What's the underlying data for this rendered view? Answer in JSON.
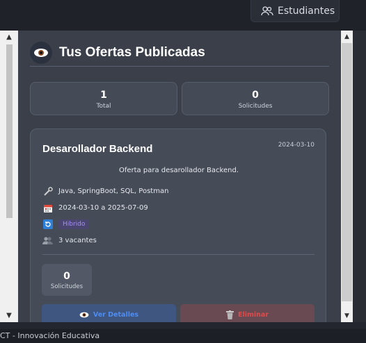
{
  "topbar": {
    "students_label": "Estudiantes"
  },
  "modal": {
    "title": "Tus Ofertas Publicadas",
    "stats": [
      {
        "value": "1",
        "label": "Total"
      },
      {
        "value": "0",
        "label": "Solicitudes"
      }
    ]
  },
  "offer": {
    "title": "Desarollador Backend",
    "date": "2024-03-10",
    "description": "Oferta para desarollador Backend.",
    "skills": "Java, SpringBoot, SQL, Postman",
    "period": "2024-03-10 a 2025-07-09",
    "modality": "Hibrido",
    "vacancies": "3 vacantes",
    "requests_value": "0",
    "requests_label": "Solicitudes",
    "view_label": "Ver Detalles",
    "delete_label": "Eliminar"
  },
  "footer": {
    "text": "CT - Innovación Educativa"
  },
  "colors": {
    "panel": "#3a3f4a",
    "accent": "#2fbf9a",
    "view": "#4f8cf0",
    "delete": "#e04a4a",
    "badge": "#a48ff5"
  },
  "icons": [
    "users-icon",
    "eye-icon",
    "wrench-icon",
    "calendar-icon",
    "refresh-icon",
    "people-icon",
    "trash-icon"
  ]
}
